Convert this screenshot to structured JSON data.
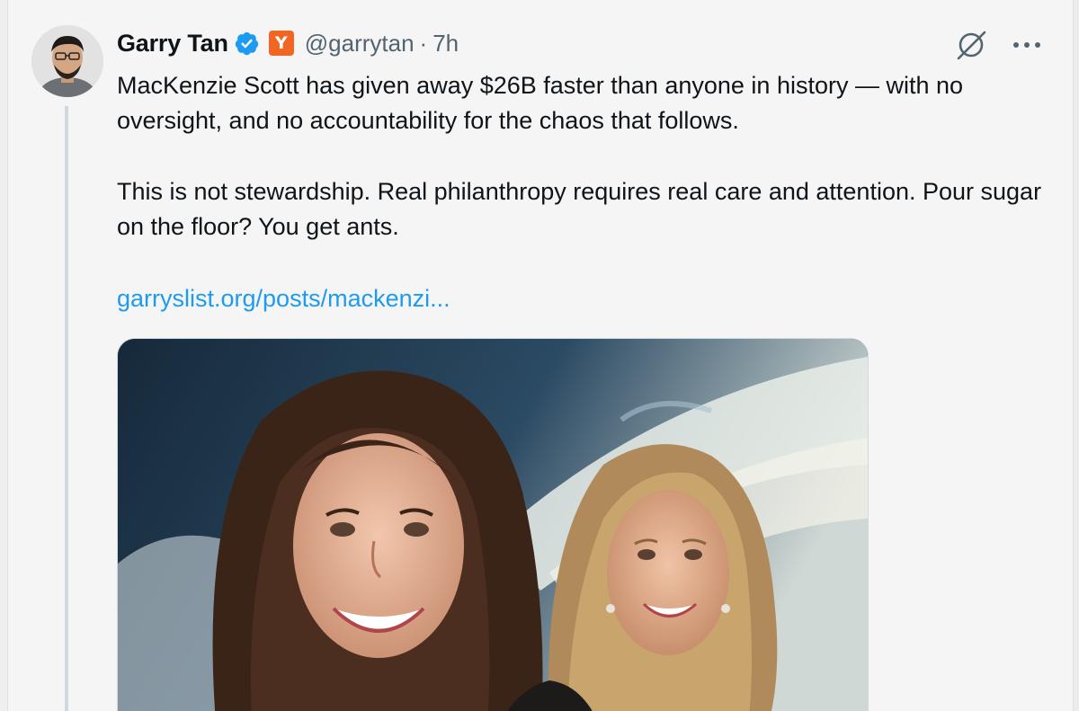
{
  "tweet": {
    "author": {
      "display_name": "Garry Tan",
      "handle": "@garrytan",
      "verified_icon": "verified-badge-icon",
      "affiliate_badge": "Y"
    },
    "separator": "·",
    "time": "7h",
    "text_lines": [
      "MacKenzie Scott has given away $26B faster than anyone in history — with no oversight, and no accountability for the chaos that follows.",
      "This is not stewardship. Real philanthropy requires real care and attention. Pour sugar on the floor? You get ants."
    ],
    "link_text": "garryslist.org/posts/mackenzi...",
    "actions": {
      "grok_icon": "grok-icon",
      "more_icon": "more-icon"
    },
    "media": {
      "type": "image",
      "icon": "portrait-illustration"
    }
  },
  "colors": {
    "link": "#1d9bf0",
    "verified": "#1d9bf0",
    "yc_badge": "#f26522",
    "secondary_text": "#536471"
  }
}
